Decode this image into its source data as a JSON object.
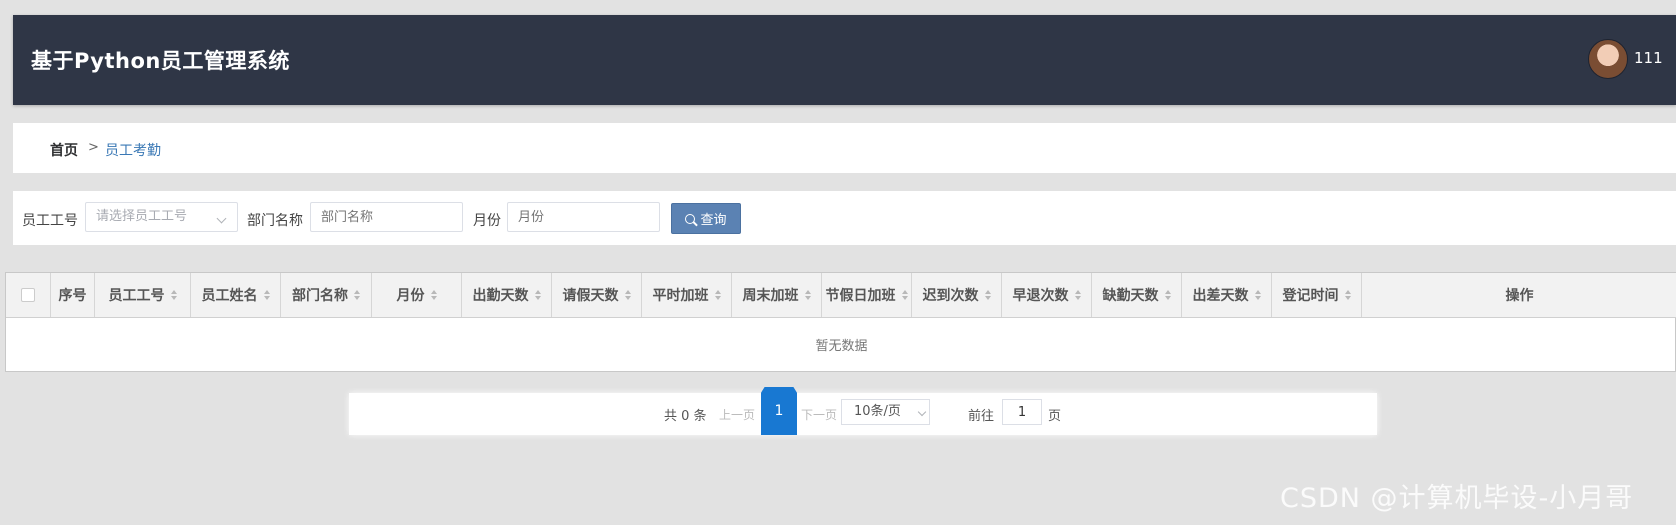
{
  "header": {
    "title": "基于Python员工管理系统",
    "username": "111"
  },
  "breadcrumb": {
    "home": "首页",
    "separator": ">",
    "current": "员工考勤"
  },
  "filters": {
    "emp_no_label": "员工工号",
    "emp_no_placeholder": "请选择员工工号",
    "dept_label": "部门名称",
    "dept_placeholder": "部门名称",
    "month_label": "月份",
    "month_placeholder": "月份",
    "query_label": "查询"
  },
  "table": {
    "columns": [
      "序号",
      "员工工号",
      "员工姓名",
      "部门名称",
      "月份",
      "出勤天数",
      "请假天数",
      "平时加班",
      "周末加班",
      "节假日加班",
      "迟到次数",
      "早退次数",
      "缺勤天数",
      "出差天数",
      "登记时间",
      "操作"
    ],
    "empty_text": "暂无数据"
  },
  "pagination": {
    "total": "共 0 条",
    "prev": "上一页",
    "current_page": "1",
    "next": "下一页",
    "page_size": "10条/页",
    "goto_label": "前往",
    "goto_value": "1",
    "page_suffix": "页"
  },
  "watermark": "CSDN @计算机毕设-小月哥",
  "colors": {
    "header_bg": "#2f3646",
    "primary": "#1878d2",
    "query_btn": "#5b82b3",
    "link": "#3a78b5"
  }
}
